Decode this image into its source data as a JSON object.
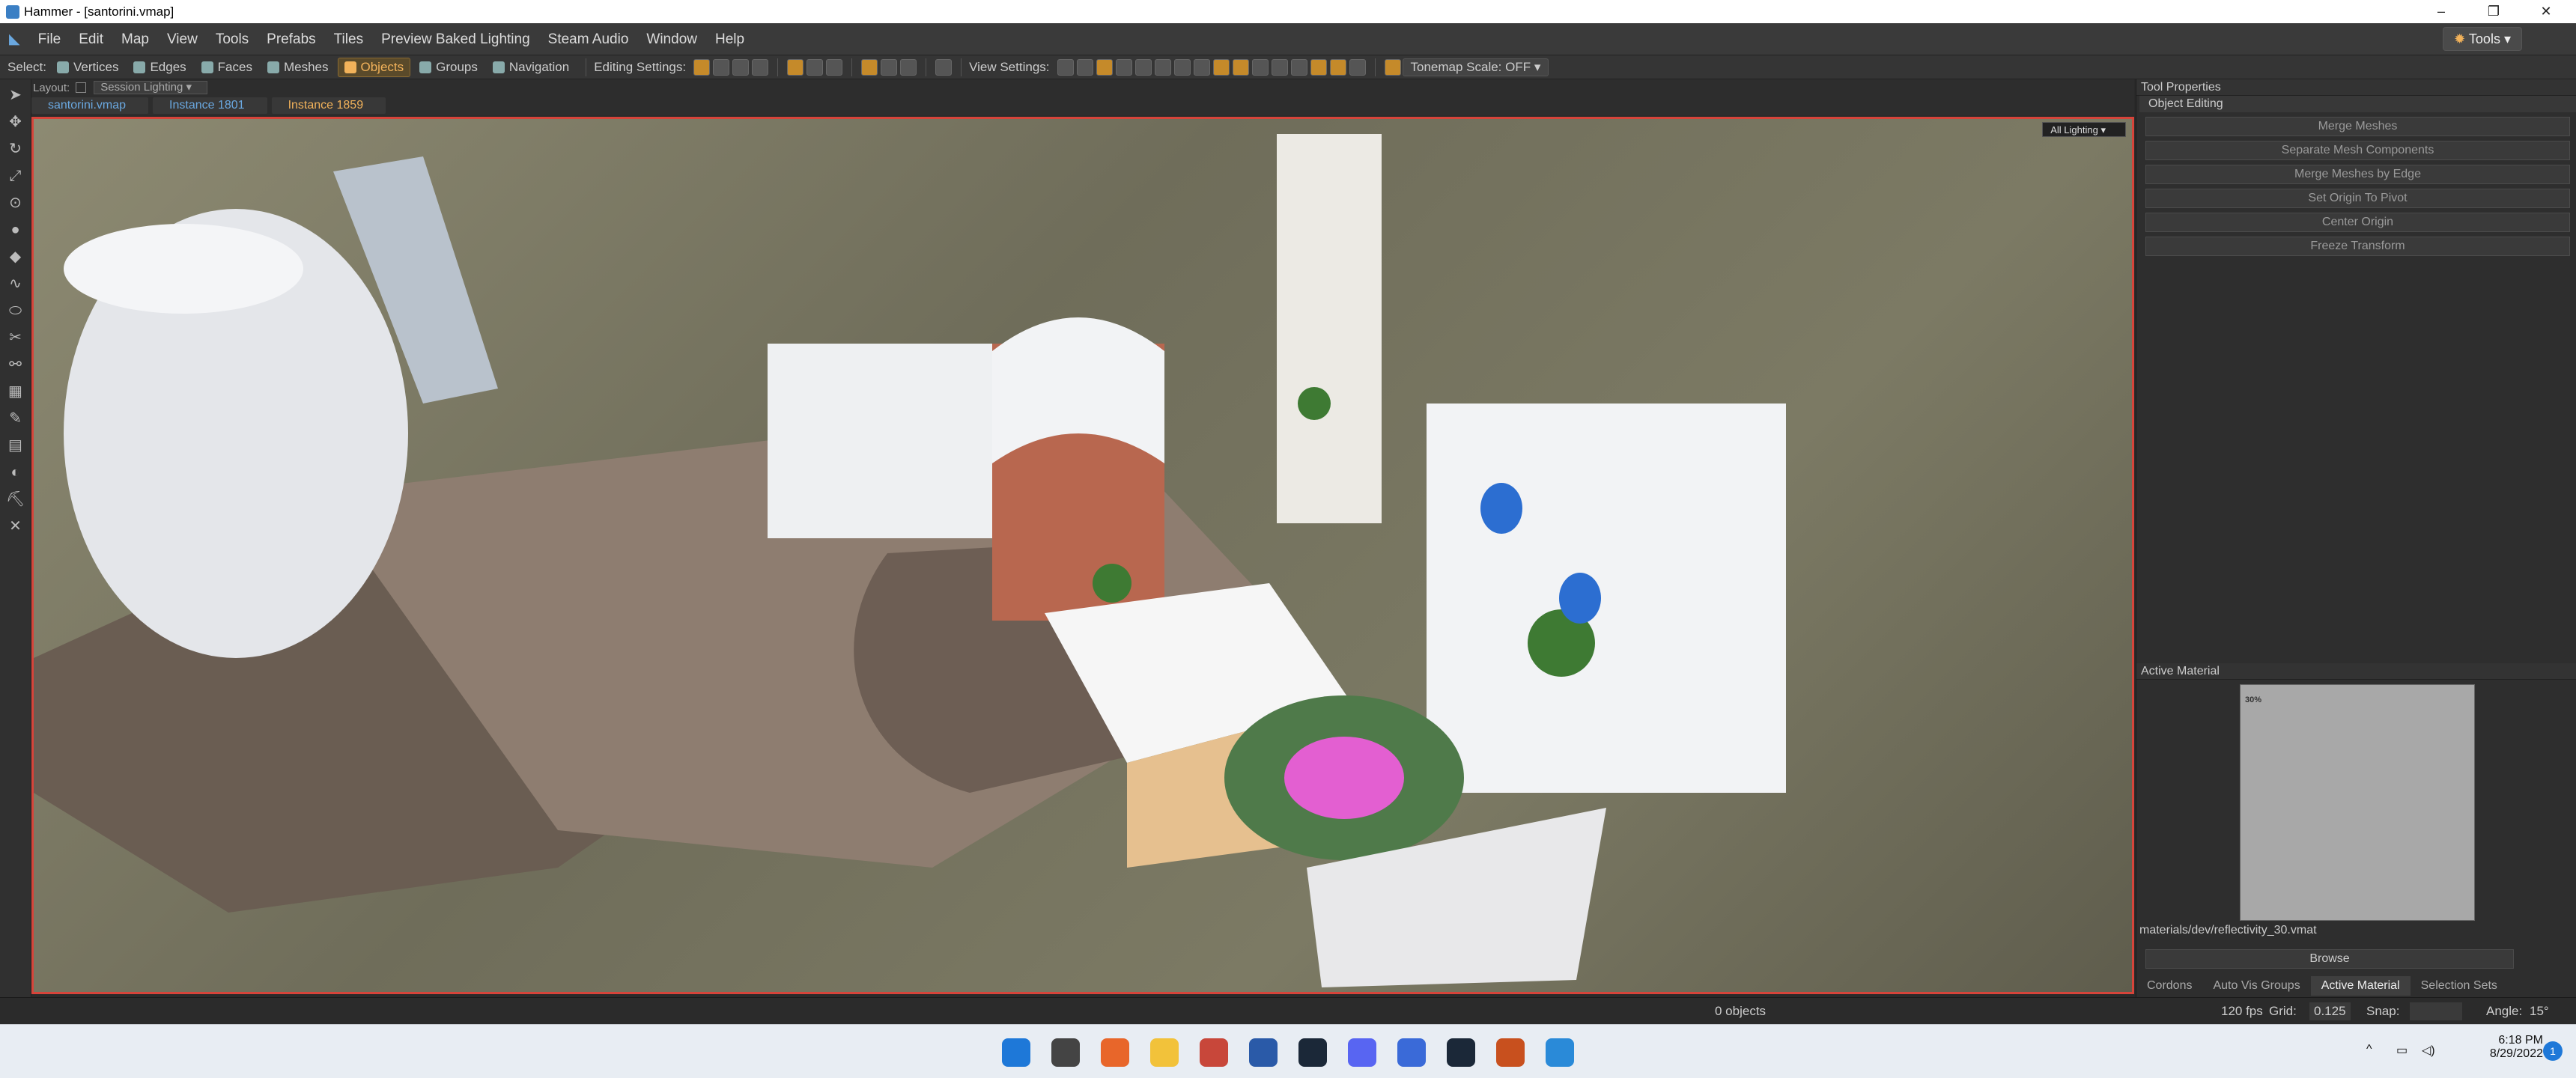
{
  "window": {
    "title": "Hammer - [santorini.vmap]",
    "minimize": "–",
    "maximize": "❐",
    "close": "✕"
  },
  "menu": {
    "items": [
      "File",
      "Edit",
      "Map",
      "View",
      "Tools",
      "Prefabs",
      "Tiles",
      "Preview Baked Lighting",
      "Steam Audio",
      "Window",
      "Help"
    ],
    "tools_button": "Tools"
  },
  "toolbar": {
    "select_label": "Select:",
    "select_modes": [
      "Vertices",
      "Edges",
      "Faces",
      "Meshes",
      "Objects",
      "Groups",
      "Navigation"
    ],
    "active_mode": "Objects",
    "editing_label": "Editing Settings:",
    "view_label": "View Settings:",
    "tonemap": "Tonemap Scale: OFF"
  },
  "layout": {
    "label": "Layout:",
    "dropdown": "Session Lighting"
  },
  "breadcrumb": [
    "santorini.vmap",
    "Instance 1801",
    "Instance 1859"
  ],
  "viewport": {
    "lighting_dropdown": "All Lighting"
  },
  "tool_properties": {
    "title": "Tool Properties",
    "section": "Object Editing",
    "buttons": [
      "Merge Meshes",
      "Separate Mesh Components",
      "Merge Meshes by Edge",
      "Set Origin To Pivot",
      "Center Origin",
      "Freeze Transform"
    ]
  },
  "active_material": {
    "title": "Active Material",
    "thumb_label": "30%",
    "path": "materials/dev/reflectivity_30.vmat",
    "browse": "Browse"
  },
  "panel_tabs": [
    "Cordons",
    "Auto Vis Groups",
    "Active Material",
    "Selection Sets"
  ],
  "status": {
    "objects": "0 objects",
    "fps": "120 fps",
    "grid_label": "Grid:",
    "grid_value": "0.125",
    "snap_label": "Snap:",
    "angle_label": "Angle:",
    "angle_value": "15°"
  },
  "taskbar": {
    "time": "6:18 PM",
    "date": "8/29/2022",
    "notifications": "1"
  },
  "colors": {
    "accent": "#f2b25a",
    "viewport_border": "#d6443a"
  }
}
